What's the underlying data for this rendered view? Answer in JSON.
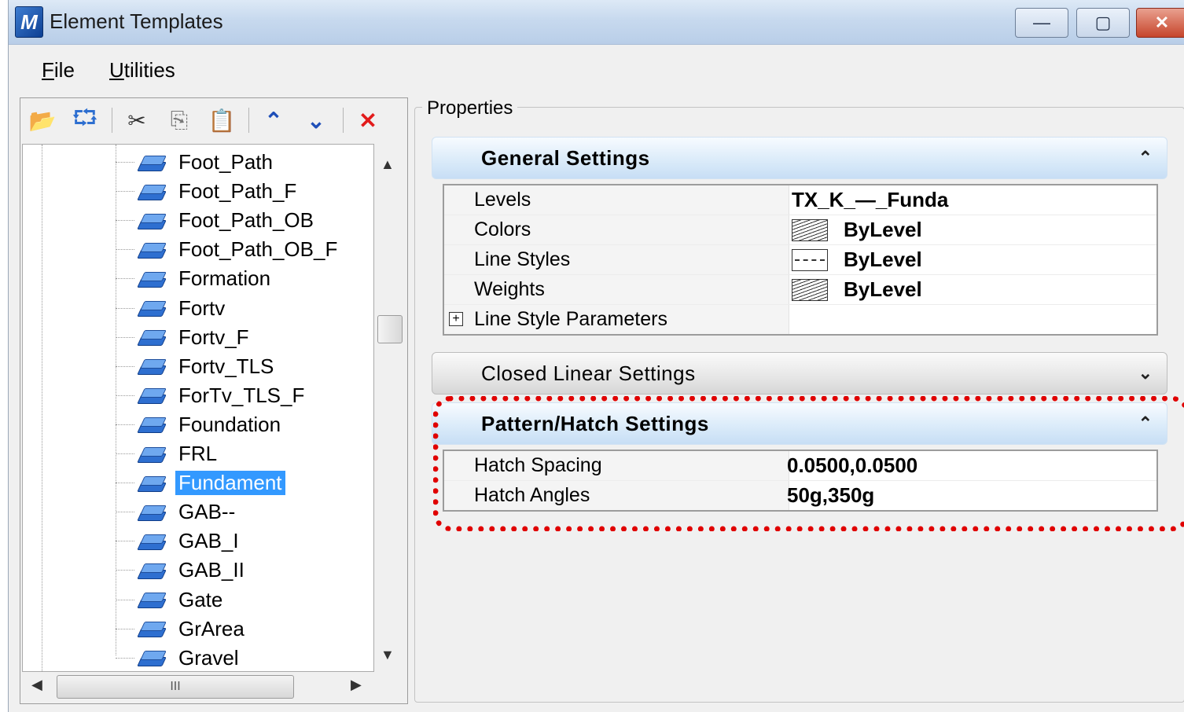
{
  "window": {
    "title": "Element Templates",
    "app_icon_glyph": "M",
    "controls": {
      "minimize": "—",
      "maximize": "▢",
      "close": "✕"
    }
  },
  "menu": {
    "file": {
      "hotkey": "F",
      "rest": "ile"
    },
    "utilities": {
      "hotkey": "U",
      "rest": "tilities"
    }
  },
  "toolbar": {
    "icons": [
      "open-folder-icon",
      "import-icon",
      "cut-icon",
      "copy-icon",
      "paste-icon",
      "move-up-icon",
      "move-down-icon",
      "delete-icon"
    ],
    "glyphs": {
      "open": "📂",
      "import": "⮔",
      "cut": "✂",
      "copy": "⎘",
      "paste": "📋",
      "up": "⌃",
      "down": "⌄",
      "delete": "✕"
    },
    "colors": {
      "up_down": "#1f4fb8",
      "delete": "#e21b1b"
    }
  },
  "tree": {
    "items": [
      "Foot_Path",
      "Foot_Path_F",
      "Foot_Path_OB",
      "Foot_Path_OB_F",
      "Formation",
      "Fortv",
      "Fortv_F",
      "Fortv_TLS",
      "ForTv_TLS_F",
      "Foundation",
      "FRL",
      "Fundament",
      "GAB--",
      "GAB_I",
      "GAB_II",
      "Gate",
      "GrArea",
      "Gravel"
    ],
    "selected": "Fundament",
    "selected_color": "#3399ff",
    "scroll": {
      "up": "▲",
      "down": "▼",
      "left": "◀",
      "right": "▶",
      "thumb_grip": "III"
    }
  },
  "properties": {
    "label": "Properties",
    "general": {
      "title": "General Settings",
      "chevron": "⌃",
      "rows": [
        {
          "name": "Levels",
          "value": "TX_K_—_Funda"
        },
        {
          "name": "Colors",
          "value": "ByLevel"
        },
        {
          "name": "Line Styles",
          "value": "ByLevel"
        },
        {
          "name": "Weights",
          "value": "ByLevel"
        },
        {
          "name": "Line Style Parameters",
          "value": ""
        }
      ],
      "expander": "+"
    },
    "closed_linear": {
      "title": "Closed Linear Settings",
      "chevron": "⌄"
    },
    "pattern_hatch": {
      "title": "Pattern/Hatch Settings",
      "chevron": "⌃",
      "rows": [
        {
          "name": "Hatch Spacing",
          "value": "0.0500,0.0500"
        },
        {
          "name": "Hatch Angles",
          "value": "50g,350g"
        }
      ]
    },
    "highlight_color": "#e00000"
  }
}
